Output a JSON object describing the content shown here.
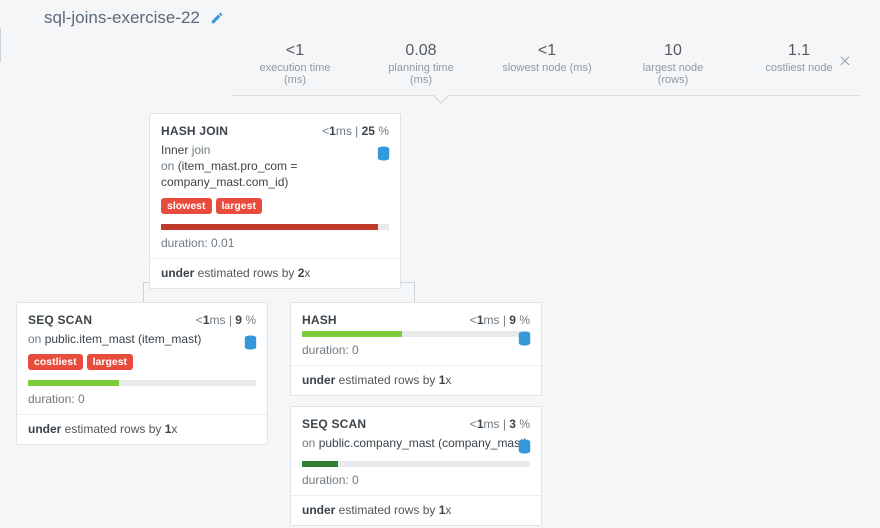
{
  "title": "sql-joins-exercise-22",
  "stats": [
    {
      "value": "<1",
      "label": "execution time (ms)"
    },
    {
      "value": "0.08",
      "label": "planning time (ms)"
    },
    {
      "value": "<1",
      "label": "slowest node (ms)"
    },
    {
      "value": "10",
      "label": "largest node (rows)"
    },
    {
      "value": "1.1",
      "label": "costliest node"
    }
  ],
  "nodes": {
    "hashjoin": {
      "type": "HASH JOIN",
      "time_prefix": "<",
      "time_val": "1",
      "time_unit": "ms",
      "pct": "25",
      "sub1_a": "Inner",
      "sub1_b": " join",
      "sub2_a": "on ",
      "sub2_b": "(item_mast.pro_com = company_mast.com_id)",
      "tags": [
        "slowest",
        "largest"
      ],
      "bar_pct": 95,
      "duration_label": "duration: ",
      "duration_val": "0.01",
      "est_a": "under",
      "est_b": " estimated rows by ",
      "est_c": "2",
      "est_d": "x"
    },
    "seq1": {
      "type": "SEQ SCAN",
      "time_prefix": "<",
      "time_val": "1",
      "time_unit": "ms",
      "pct": "9",
      "sub_a": "on ",
      "sub_b": "public.item_mast (item_mast)",
      "tags": [
        "costliest",
        "largest"
      ],
      "bar_pct": 40,
      "duration_label": "duration: ",
      "duration_val": "0",
      "est_a": "under",
      "est_b": " estimated rows by ",
      "est_c": "1",
      "est_d": "x"
    },
    "hash": {
      "type": "HASH",
      "time_prefix": "<",
      "time_val": "1",
      "time_unit": "ms",
      "pct": "9",
      "bar_pct": 44,
      "duration_label": "duration: ",
      "duration_val": "0",
      "est_a": "under",
      "est_b": " estimated rows by ",
      "est_c": "1",
      "est_d": "x"
    },
    "seq2": {
      "type": "SEQ SCAN",
      "time_prefix": "<",
      "time_val": "1",
      "time_unit": "ms",
      "pct": "3",
      "sub_a": "on ",
      "sub_b": "public.company_mast (company_mast)",
      "bar_pct": 16,
      "duration_label": "duration: ",
      "duration_val": "0",
      "est_a": "under",
      "est_b": " estimated rows by ",
      "est_c": "1",
      "est_d": "x"
    }
  }
}
